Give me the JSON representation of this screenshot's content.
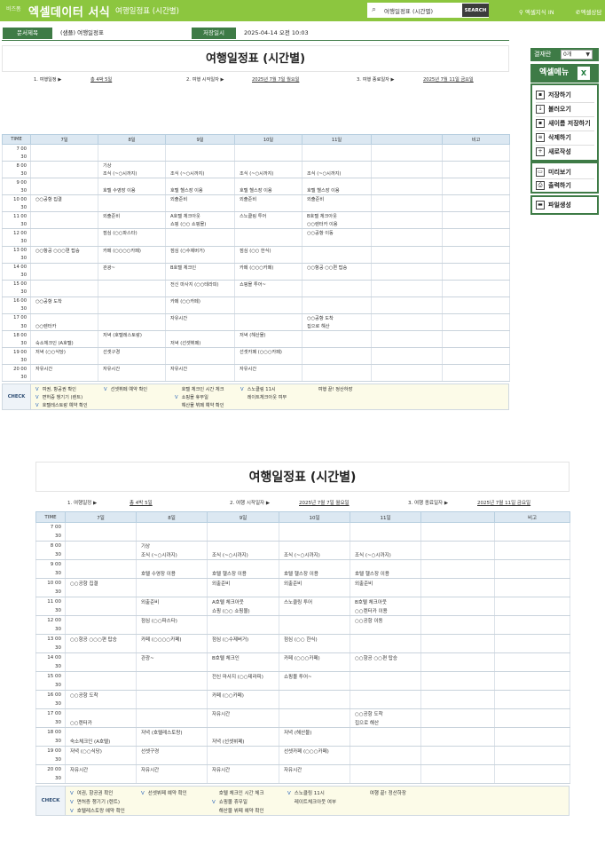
{
  "topbar": {
    "brand_small": "비즈폼",
    "brand": "엑셀데이터 서식",
    "subtitle": "여행일정표 (시간별)",
    "search_value": "여행일정표 (시간별)",
    "search_button": "SEARCH",
    "link1": "엑셀지식 IN",
    "link2": "엑셀상담"
  },
  "docinfo": {
    "title_label": "문서제목",
    "title_value": "(샘플) 여행일정표",
    "saved_label": "저장일시",
    "saved_value": "2025-04-14   오전 10:03"
  },
  "sheet": {
    "title": "여행일정표 (시간별)",
    "info": {
      "item1_label": "1. 여행일정  ▶",
      "item1_value": "총 4박 5일",
      "item2_label": "2. 여행 시작일자  ▶",
      "item2_value": "2025년 7월 7일 월요일",
      "item3_label": "3. 여행 종료일자  ▶",
      "item3_value": "2025년 7월 11일 금요일"
    },
    "headers": [
      "TIME",
      "7일",
      "8일",
      "9일",
      "10일",
      "11일",
      "",
      "비고"
    ],
    "rows": [
      [
        "7 00",
        "",
        "",
        "",
        "",
        "",
        "",
        ""
      ],
      [
        "30",
        "",
        "",
        "",
        "",
        "",
        "",
        ""
      ],
      [
        "8 00",
        "",
        "기상",
        "",
        "",
        "",
        "",
        ""
      ],
      [
        "30",
        "",
        "조식 (~○시까지)",
        "조식 (~○시까지)",
        "조식 (~○시까지)",
        "조식 (~○시까지)",
        "",
        ""
      ],
      [
        "9 00",
        "",
        "",
        "",
        "",
        "",
        "",
        ""
      ],
      [
        "30",
        "",
        "호텔 수영장 이용",
        "호텔 헬스장 이용",
        "호텔 헬스장 이용",
        "호텔 헬스장 이용",
        "",
        ""
      ],
      [
        "10 00",
        "○○공항 집결",
        "",
        "외출준비",
        "외출준비",
        "외출준비",
        "",
        ""
      ],
      [
        "30",
        "",
        "",
        "",
        "",
        "",
        "",
        ""
      ],
      [
        "11 00",
        "",
        "외출준비",
        "A호텔 체크아웃",
        "스노클링 투어",
        "B호텔 체크아웃",
        "",
        ""
      ],
      [
        "30",
        "",
        "",
        "쇼핑 (○○ 쇼핑몰)",
        "",
        "○○렌터카 이용",
        "",
        ""
      ],
      [
        "12 00",
        "",
        "점심 (○○파스타)",
        "",
        "",
        "○○공항 이동",
        "",
        ""
      ],
      [
        "30",
        "",
        "",
        "",
        "",
        "",
        "",
        ""
      ],
      [
        "13 00",
        "○○항공 ○○○편 탑승",
        "카페 (○○○○카페)",
        "점심 (○수제버거)",
        "점심 (○○ 한식)",
        "",
        "",
        ""
      ],
      [
        "30",
        "",
        "",
        "",
        "",
        "",
        "",
        ""
      ],
      [
        "14 00",
        "",
        "관광~",
        "B호텔 체크인",
        "카페 (○○○카페)",
        "○○항공 ○○편 탑승",
        "",
        ""
      ],
      [
        "30",
        "",
        "",
        "",
        "",
        "",
        "",
        ""
      ],
      [
        "15 00",
        "",
        "",
        "전신 마사지 (○○테라피)",
        "쇼핑몰 투어~",
        "",
        "",
        ""
      ],
      [
        "30",
        "",
        "",
        "",
        "",
        "",
        "",
        ""
      ],
      [
        "16 00",
        "○○공항 도착",
        "",
        "카페 (○○카페)",
        "",
        "",
        "",
        ""
      ],
      [
        "30",
        "",
        "",
        "",
        "",
        "",
        "",
        ""
      ],
      [
        "17 00",
        "",
        "",
        "자유시간",
        "",
        "○○공항 도착",
        "",
        ""
      ],
      [
        "30",
        "○○렌터카",
        "",
        "",
        "",
        "집으로 해산",
        "",
        ""
      ],
      [
        "18 00",
        "",
        "저녁 (호텔레스토랑)",
        "",
        "저녁 (해산물)",
        "",
        "",
        ""
      ],
      [
        "30",
        "숙소체크인 (A호텔)",
        "",
        "저녁 (선셋뷔페)",
        "",
        "",
        "",
        ""
      ],
      [
        "19 00",
        "저녁 (○○식당)",
        "선셋구경",
        "",
        "선셋카페 (○○○카페)",
        "",
        "",
        ""
      ],
      [
        "30",
        "",
        "",
        "",
        "",
        "",
        "",
        ""
      ],
      [
        "20 00",
        "자유시간",
        "자유시간",
        "자유시간",
        "자유시간",
        "",
        "",
        ""
      ],
      [
        "30",
        "",
        "",
        "",
        "",
        "",
        "",
        ""
      ]
    ],
    "check_label": "CHECK",
    "checks": [
      "여권, 항공권 확인",
      "면허증 챙기기 (렌트)",
      "호텔레스토랑 예약 확인",
      "선셋뷔페 예약 확인",
      "호텔 체크인 시간 체크",
      "쇼핑몰 휴무일",
      "해산물 뷔페 예약 확인",
      "스노클링 11시",
      "레이트체크아웃 여부",
      "여행 끝! 정산하장"
    ],
    "check_mark": "V"
  },
  "sidebar": {
    "pay_label": "결재란",
    "pay_select": "0개",
    "menu_title": "엑셀메뉴",
    "items": [
      "저장하기",
      "불러오기",
      "새이름 저장하기",
      "삭제하기",
      "새로작성"
    ],
    "items2": [
      "미리보기",
      "출력하기"
    ],
    "items3": [
      "파일생성"
    ]
  }
}
